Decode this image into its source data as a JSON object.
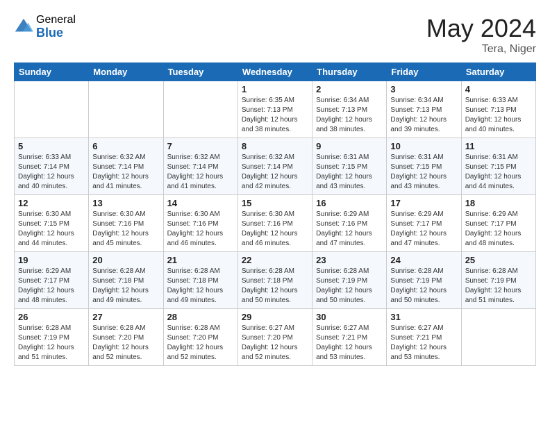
{
  "header": {
    "logo_general": "General",
    "logo_blue": "Blue",
    "month_title": "May 2024",
    "location": "Tera, Niger"
  },
  "days_of_week": [
    "Sunday",
    "Monday",
    "Tuesday",
    "Wednesday",
    "Thursday",
    "Friday",
    "Saturday"
  ],
  "weeks": [
    [
      {
        "day": "",
        "sunrise": "",
        "sunset": "",
        "daylight": ""
      },
      {
        "day": "",
        "sunrise": "",
        "sunset": "",
        "daylight": ""
      },
      {
        "day": "",
        "sunrise": "",
        "sunset": "",
        "daylight": ""
      },
      {
        "day": "1",
        "sunrise": "Sunrise: 6:35 AM",
        "sunset": "Sunset: 7:13 PM",
        "daylight": "Daylight: 12 hours and 38 minutes."
      },
      {
        "day": "2",
        "sunrise": "Sunrise: 6:34 AM",
        "sunset": "Sunset: 7:13 PM",
        "daylight": "Daylight: 12 hours and 38 minutes."
      },
      {
        "day": "3",
        "sunrise": "Sunrise: 6:34 AM",
        "sunset": "Sunset: 7:13 PM",
        "daylight": "Daylight: 12 hours and 39 minutes."
      },
      {
        "day": "4",
        "sunrise": "Sunrise: 6:33 AM",
        "sunset": "Sunset: 7:13 PM",
        "daylight": "Daylight: 12 hours and 40 minutes."
      }
    ],
    [
      {
        "day": "5",
        "sunrise": "Sunrise: 6:33 AM",
        "sunset": "Sunset: 7:14 PM",
        "daylight": "Daylight: 12 hours and 40 minutes."
      },
      {
        "day": "6",
        "sunrise": "Sunrise: 6:32 AM",
        "sunset": "Sunset: 7:14 PM",
        "daylight": "Daylight: 12 hours and 41 minutes."
      },
      {
        "day": "7",
        "sunrise": "Sunrise: 6:32 AM",
        "sunset": "Sunset: 7:14 PM",
        "daylight": "Daylight: 12 hours and 41 minutes."
      },
      {
        "day": "8",
        "sunrise": "Sunrise: 6:32 AM",
        "sunset": "Sunset: 7:14 PM",
        "daylight": "Daylight: 12 hours and 42 minutes."
      },
      {
        "day": "9",
        "sunrise": "Sunrise: 6:31 AM",
        "sunset": "Sunset: 7:15 PM",
        "daylight": "Daylight: 12 hours and 43 minutes."
      },
      {
        "day": "10",
        "sunrise": "Sunrise: 6:31 AM",
        "sunset": "Sunset: 7:15 PM",
        "daylight": "Daylight: 12 hours and 43 minutes."
      },
      {
        "day": "11",
        "sunrise": "Sunrise: 6:31 AM",
        "sunset": "Sunset: 7:15 PM",
        "daylight": "Daylight: 12 hours and 44 minutes."
      }
    ],
    [
      {
        "day": "12",
        "sunrise": "Sunrise: 6:30 AM",
        "sunset": "Sunset: 7:15 PM",
        "daylight": "Daylight: 12 hours and 44 minutes."
      },
      {
        "day": "13",
        "sunrise": "Sunrise: 6:30 AM",
        "sunset": "Sunset: 7:16 PM",
        "daylight": "Daylight: 12 hours and 45 minutes."
      },
      {
        "day": "14",
        "sunrise": "Sunrise: 6:30 AM",
        "sunset": "Sunset: 7:16 PM",
        "daylight": "Daylight: 12 hours and 46 minutes."
      },
      {
        "day": "15",
        "sunrise": "Sunrise: 6:30 AM",
        "sunset": "Sunset: 7:16 PM",
        "daylight": "Daylight: 12 hours and 46 minutes."
      },
      {
        "day": "16",
        "sunrise": "Sunrise: 6:29 AM",
        "sunset": "Sunset: 7:16 PM",
        "daylight": "Daylight: 12 hours and 47 minutes."
      },
      {
        "day": "17",
        "sunrise": "Sunrise: 6:29 AM",
        "sunset": "Sunset: 7:17 PM",
        "daylight": "Daylight: 12 hours and 47 minutes."
      },
      {
        "day": "18",
        "sunrise": "Sunrise: 6:29 AM",
        "sunset": "Sunset: 7:17 PM",
        "daylight": "Daylight: 12 hours and 48 minutes."
      }
    ],
    [
      {
        "day": "19",
        "sunrise": "Sunrise: 6:29 AM",
        "sunset": "Sunset: 7:17 PM",
        "daylight": "Daylight: 12 hours and 48 minutes."
      },
      {
        "day": "20",
        "sunrise": "Sunrise: 6:28 AM",
        "sunset": "Sunset: 7:18 PM",
        "daylight": "Daylight: 12 hours and 49 minutes."
      },
      {
        "day": "21",
        "sunrise": "Sunrise: 6:28 AM",
        "sunset": "Sunset: 7:18 PM",
        "daylight": "Daylight: 12 hours and 49 minutes."
      },
      {
        "day": "22",
        "sunrise": "Sunrise: 6:28 AM",
        "sunset": "Sunset: 7:18 PM",
        "daylight": "Daylight: 12 hours and 50 minutes."
      },
      {
        "day": "23",
        "sunrise": "Sunrise: 6:28 AM",
        "sunset": "Sunset: 7:19 PM",
        "daylight": "Daylight: 12 hours and 50 minutes."
      },
      {
        "day": "24",
        "sunrise": "Sunrise: 6:28 AM",
        "sunset": "Sunset: 7:19 PM",
        "daylight": "Daylight: 12 hours and 50 minutes."
      },
      {
        "day": "25",
        "sunrise": "Sunrise: 6:28 AM",
        "sunset": "Sunset: 7:19 PM",
        "daylight": "Daylight: 12 hours and 51 minutes."
      }
    ],
    [
      {
        "day": "26",
        "sunrise": "Sunrise: 6:28 AM",
        "sunset": "Sunset: 7:19 PM",
        "daylight": "Daylight: 12 hours and 51 minutes."
      },
      {
        "day": "27",
        "sunrise": "Sunrise: 6:28 AM",
        "sunset": "Sunset: 7:20 PM",
        "daylight": "Daylight: 12 hours and 52 minutes."
      },
      {
        "day": "28",
        "sunrise": "Sunrise: 6:28 AM",
        "sunset": "Sunset: 7:20 PM",
        "daylight": "Daylight: 12 hours and 52 minutes."
      },
      {
        "day": "29",
        "sunrise": "Sunrise: 6:27 AM",
        "sunset": "Sunset: 7:20 PM",
        "daylight": "Daylight: 12 hours and 52 minutes."
      },
      {
        "day": "30",
        "sunrise": "Sunrise: 6:27 AM",
        "sunset": "Sunset: 7:21 PM",
        "daylight": "Daylight: 12 hours and 53 minutes."
      },
      {
        "day": "31",
        "sunrise": "Sunrise: 6:27 AM",
        "sunset": "Sunset: 7:21 PM",
        "daylight": "Daylight: 12 hours and 53 minutes."
      },
      {
        "day": "",
        "sunrise": "",
        "sunset": "",
        "daylight": ""
      }
    ]
  ]
}
